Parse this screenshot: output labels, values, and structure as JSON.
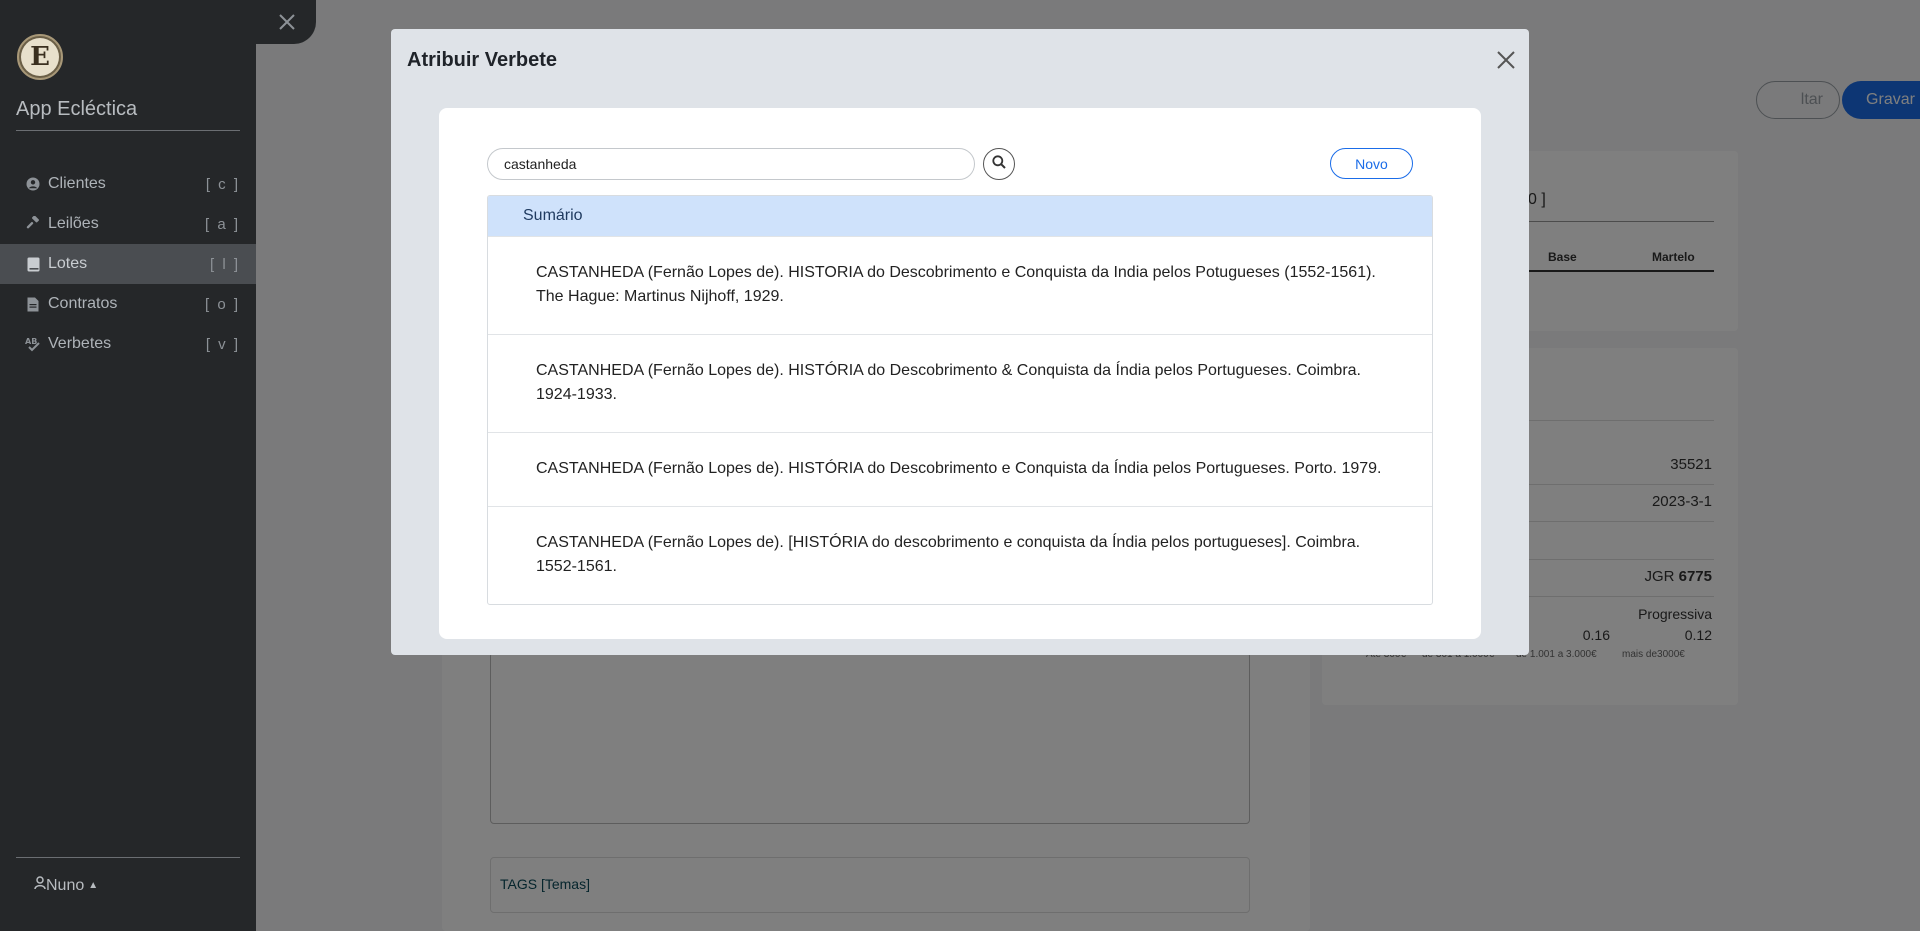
{
  "sidebar": {
    "app_title": "App Ecléctica",
    "logo_letter": "E",
    "items": [
      {
        "label": "Clientes",
        "key": "[ c ]",
        "icon": "user-circle-icon"
      },
      {
        "label": "Leilões",
        "key": "[ a ]",
        "icon": "gavel-icon"
      },
      {
        "label": "Lotes",
        "key": "[ l ]",
        "icon": "book-icon",
        "active": true
      },
      {
        "label": "Contratos",
        "key": "[ o ]",
        "icon": "file-icon"
      },
      {
        "label": "Verbetes",
        "key": "[ v ]",
        "icon": "spellcheck-icon"
      }
    ],
    "user": "Nuno"
  },
  "background": {
    "voltar_label": "ltar",
    "gravar_label": "Gravar",
    "help_label": "?",
    "card1_title": "0 ]",
    "card1_col_base": "Base",
    "card1_col_martelo": "Martelo",
    "values": [
      "35521",
      "2023-3-1"
    ],
    "jgr_prefix": "JGR ",
    "jgr_number": "6775",
    "progressiva_label": "Progressiva",
    "rate1": "0.16",
    "rate2": "0.12",
    "scale_labels": [
      "Até 300€",
      "de 301 a 1.000€",
      "de 1.001 a 3.000€",
      "mais de3000€"
    ],
    "tags_label": "TAGS [Temas]"
  },
  "modal": {
    "title": "Atribuir Verbete",
    "search": {
      "value": "castanheda",
      "placeholder": ""
    },
    "novo_label": "Novo",
    "results_header": "Sumário",
    "results": [
      "CASTANHEDA (Fernão Lopes de). HISTORIA do Descobrimento e Conquista da India pelos Potugueses (1552-1561). The Hague: Martinus Nijhoff, 1929.",
      "CASTANHEDA (Fernão Lopes de). HISTÓRIA do Descobrimento & Conquista da Índia pelos Portugueses. Coimbra. 1924-1933.",
      "CASTANHEDA (Fernão Lopes de). HISTÓRIA do Descobrimento e Conquista da Índia pelos Portugueses. Porto. 1979.",
      "CASTANHEDA (Fernão Lopes de). [HISTÓRIA do descobrimento e conquista da Índia pelos portugueses]. Coimbra. 1552-1561."
    ]
  },
  "colors": {
    "sidebar_bg": "#252729",
    "accent": "#1a6ce8",
    "results_header_bg": "#cfe2fb"
  }
}
